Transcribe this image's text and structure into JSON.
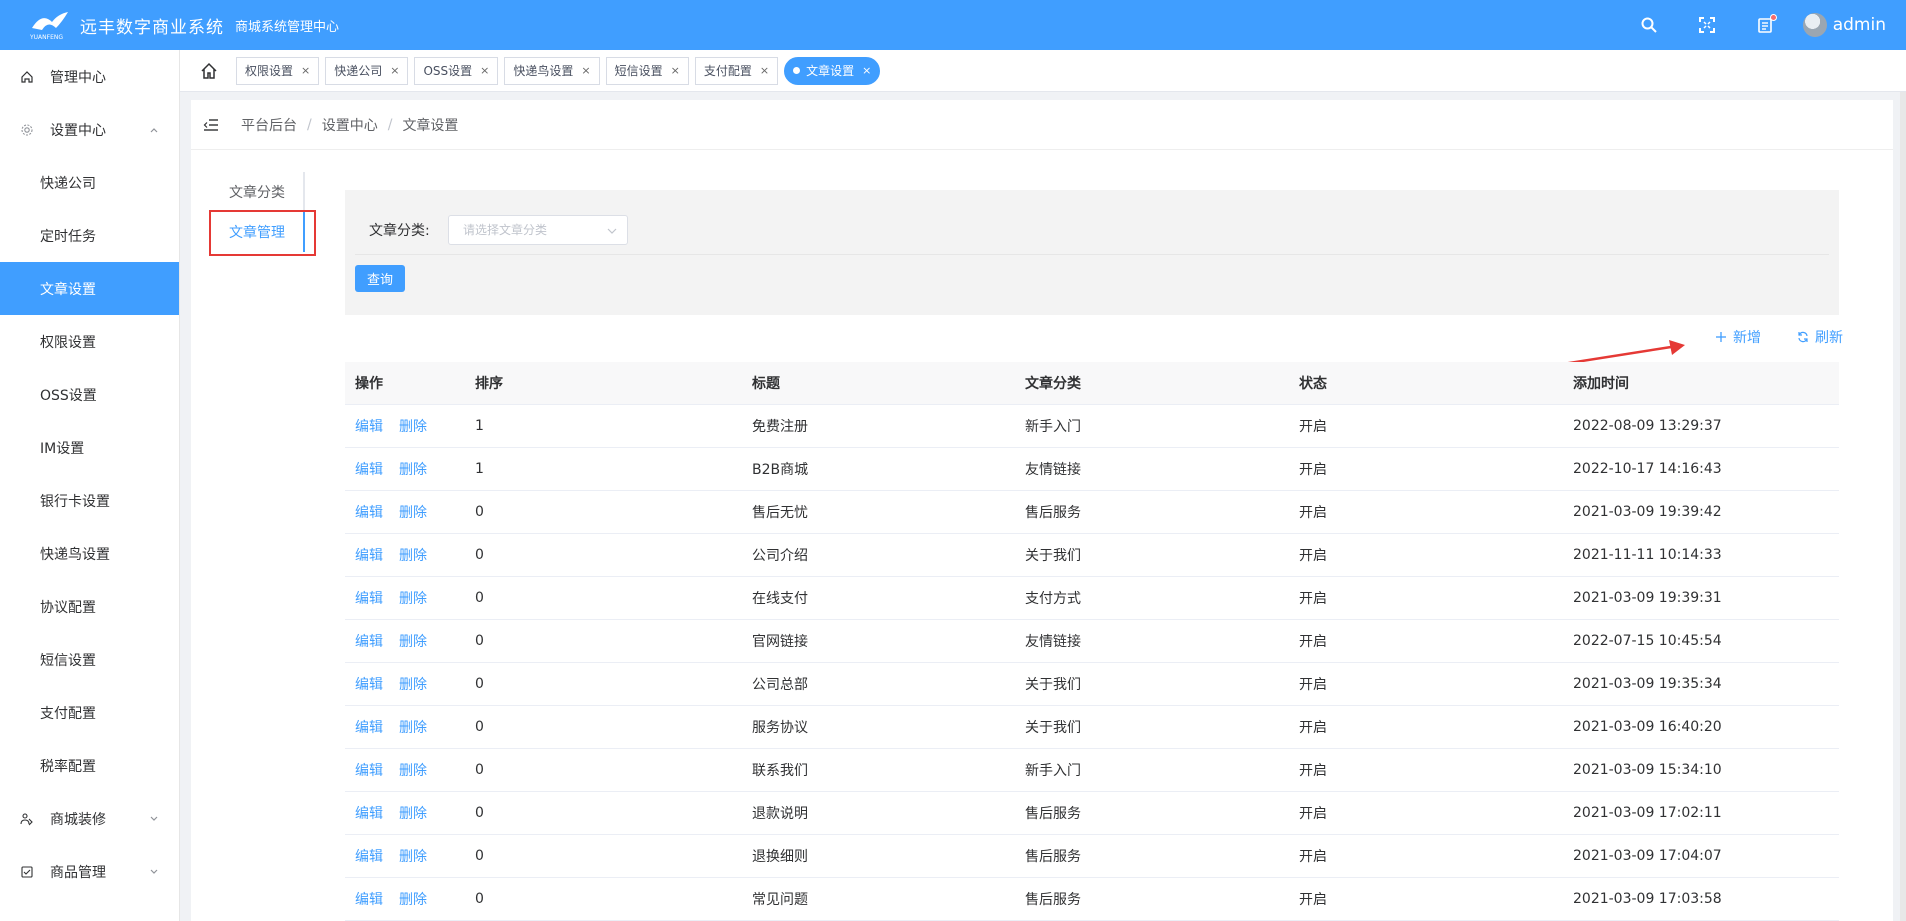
{
  "header": {
    "app_name": "远丰数字商业系统",
    "logo_text": "YUANFENG",
    "subtitle": "商城系统管理中心",
    "icons": [
      "search-icon",
      "fullscreen-icon",
      "notification-icon"
    ],
    "user": "admin"
  },
  "sidebar": {
    "items": [
      {
        "label": "管理中心",
        "icon": "home-icon"
      },
      {
        "label": "设置中心",
        "icon": "gear-icon"
      }
    ],
    "sub_items": [
      {
        "label": "快递公司"
      },
      {
        "label": "定时任务"
      },
      {
        "label": "文章设置"
      },
      {
        "label": "权限设置"
      },
      {
        "label": "OSS设置"
      },
      {
        "label": "IM设置"
      },
      {
        "label": "银行卡设置"
      },
      {
        "label": "快递鸟设置"
      },
      {
        "label": "协议配置"
      },
      {
        "label": "短信设置"
      },
      {
        "label": "支付配置"
      },
      {
        "label": "税率配置"
      }
    ],
    "bottom_items": [
      {
        "label": "商城装修",
        "icon": "decor-icon"
      },
      {
        "label": "商品管理",
        "icon": "goods-icon"
      }
    ]
  },
  "tabs": [
    {
      "label": "权限设置"
    },
    {
      "label": "快递公司"
    },
    {
      "label": "OSS设置"
    },
    {
      "label": "快递鸟设置"
    },
    {
      "label": "短信设置"
    },
    {
      "label": "支付配置"
    },
    {
      "label": "文章设置",
      "active": true
    }
  ],
  "breadcrumb": [
    "平台后台",
    "设置中心",
    "文章设置"
  ],
  "side_tabs": [
    "文章分类",
    "文章管理"
  ],
  "filter": {
    "label": "文章分类:",
    "placeholder": "请选择文章分类",
    "query_label": "查询"
  },
  "actions": {
    "add_label": "新增",
    "refresh_label": "刷新"
  },
  "table": {
    "headers": [
      "操作",
      "排序",
      "标题",
      "文章分类",
      "状态",
      "添加时间"
    ],
    "edit_label": "编辑",
    "delete_label": "删除",
    "rows": [
      {
        "sort": "1",
        "title": "免费注册",
        "category": "新手入门",
        "status": "开启",
        "time": "2022-08-09 13:29:37"
      },
      {
        "sort": "1",
        "title": "B2B商城",
        "category": "友情链接",
        "status": "开启",
        "time": "2022-10-17 14:16:43"
      },
      {
        "sort": "0",
        "title": "售后无忧",
        "category": "售后服务",
        "status": "开启",
        "time": "2021-03-09 19:39:42"
      },
      {
        "sort": "0",
        "title": "公司介绍",
        "category": "关于我们",
        "status": "开启",
        "time": "2021-11-11 10:14:33"
      },
      {
        "sort": "0",
        "title": "在线支付",
        "category": "支付方式",
        "status": "开启",
        "time": "2021-03-09 19:39:31"
      },
      {
        "sort": "0",
        "title": "官网链接",
        "category": "友情链接",
        "status": "开启",
        "time": "2022-07-15 10:45:54"
      },
      {
        "sort": "0",
        "title": "公司总部",
        "category": "关于我们",
        "status": "开启",
        "time": "2021-03-09 19:35:34"
      },
      {
        "sort": "0",
        "title": "服务协议",
        "category": "关于我们",
        "status": "开启",
        "time": "2021-03-09 16:40:20"
      },
      {
        "sort": "0",
        "title": "联系我们",
        "category": "新手入门",
        "status": "开启",
        "time": "2021-03-09 15:34:10"
      },
      {
        "sort": "0",
        "title": "退款说明",
        "category": "售后服务",
        "status": "开启",
        "time": "2021-03-09 17:02:11"
      },
      {
        "sort": "0",
        "title": "退换细则",
        "category": "售后服务",
        "status": "开启",
        "time": "2021-03-09 17:04:07"
      },
      {
        "sort": "0",
        "title": "常见问题",
        "category": "售后服务",
        "status": "开启",
        "time": "2021-03-09 17:03:58"
      }
    ]
  },
  "colors": {
    "primary": "#409eff",
    "annotation_red": "#e53935"
  }
}
